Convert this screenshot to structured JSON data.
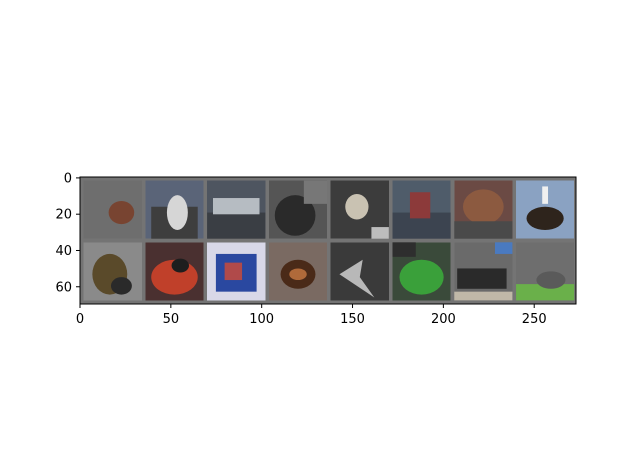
{
  "chart_data": {
    "type": "heatmap",
    "description_in_pixels": false,
    "title": "",
    "xlabel": "",
    "ylabel": "",
    "grid": false,
    "xlim": [
      0,
      273
    ],
    "ylim": [
      69.5,
      -0.5
    ],
    "xticks": [
      {
        "value": 0,
        "label": "0"
      },
      {
        "value": 50,
        "label": "50"
      },
      {
        "value": 100,
        "label": "100"
      },
      {
        "value": 150,
        "label": "150"
      },
      {
        "value": 200,
        "label": "200"
      },
      {
        "value": 250,
        "label": "250"
      }
    ],
    "yticks": [
      {
        "value": 0,
        "label": "0"
      },
      {
        "value": 20,
        "label": "20"
      },
      {
        "value": 40,
        "label": "40"
      },
      {
        "value": 60,
        "label": "60"
      }
    ],
    "tile_grid": {
      "cols": 8,
      "rows": 2,
      "tile_size": 32,
      "padding": 2
    },
    "tiles": [
      {
        "row": 0,
        "col": 0,
        "bg": "#6e6e6e",
        "accent": "#7a3a22",
        "shape": "blob-right"
      },
      {
        "row": 0,
        "col": 1,
        "bg": "#5a6478",
        "accent": "#d6d6d6",
        "shape": "animal-white"
      },
      {
        "row": 0,
        "col": 2,
        "bg": "#4e5560",
        "accent": "#b6bcc2",
        "shape": "truck"
      },
      {
        "row": 0,
        "col": 3,
        "bg": "#555555",
        "accent": "#2a2a2a",
        "shape": "cat-dark"
      },
      {
        "row": 0,
        "col": 4,
        "bg": "#3c3c3c",
        "accent": "#c9c2b2",
        "shape": "bird-white"
      },
      {
        "row": 0,
        "col": 5,
        "bg": "#4f5c6a",
        "accent": "#8c3a3a",
        "shape": "ship"
      },
      {
        "row": 0,
        "col": 6,
        "bg": "#6b4a44",
        "accent": "#8c5a40",
        "shape": "animal-brown"
      },
      {
        "row": 0,
        "col": 7,
        "bg": "#8aa2c2",
        "accent": "#2e241c",
        "shape": "horse-rider"
      },
      {
        "row": 1,
        "col": 0,
        "bg": "#8a8a8a",
        "accent": "#5a4a2a",
        "shape": "dog-spotted"
      },
      {
        "row": 1,
        "col": 1,
        "bg": "#4a3030",
        "accent": "#c0402a",
        "shape": "frog-red"
      },
      {
        "row": 1,
        "col": 2,
        "bg": "#d8d8e8",
        "accent": "#2a48a0",
        "shape": "truck-blue"
      },
      {
        "row": 1,
        "col": 3,
        "bg": "#7a6a62",
        "accent": "#4a2a18",
        "shape": "dog-face"
      },
      {
        "row": 1,
        "col": 4,
        "bg": "#3a3a3a",
        "accent": "#b8b8b8",
        "shape": "plane"
      },
      {
        "row": 1,
        "col": 5,
        "bg": "#3a4a3a",
        "accent": "#3aa03a",
        "shape": "frog-green"
      },
      {
        "row": 1,
        "col": 6,
        "bg": "#6a6a6a",
        "accent": "#2a2a2a",
        "shape": "car-black"
      },
      {
        "row": 1,
        "col": 7,
        "bg": "#6e6e6e",
        "accent": "#6ab04a",
        "shape": "field-green"
      }
    ]
  }
}
